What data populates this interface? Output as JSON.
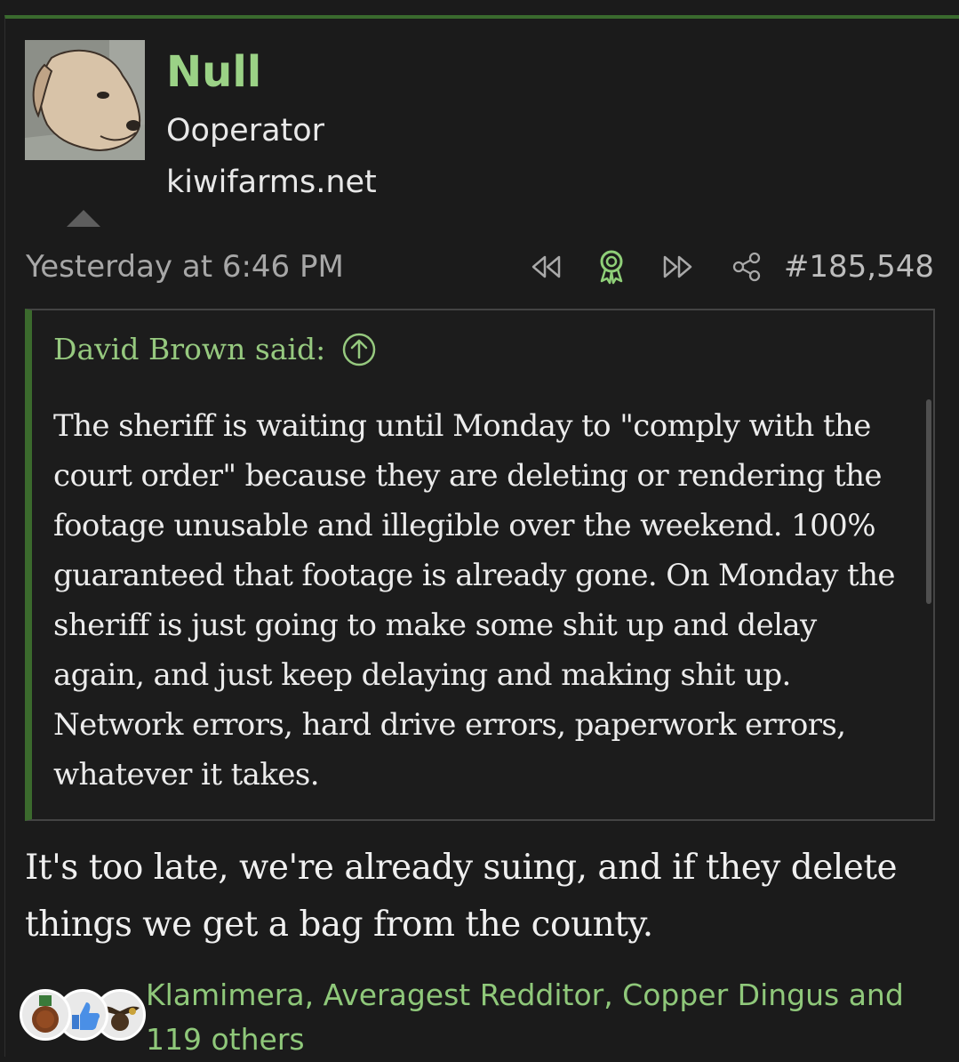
{
  "post": {
    "author": {
      "name": "Null",
      "title": "Ooperator",
      "banner": "kiwifarms.net"
    },
    "date": "Yesterday at 6:46 PM",
    "number": "#185,548",
    "actions": [
      "rewind-icon",
      "award-icon",
      "fast-forward-icon",
      "share-icon"
    ],
    "quote": {
      "attribution": "David Brown said:",
      "body": "The sheriff is waiting until Monday to \"comply with the court order\" because they are deleting or rendering the footage unusable and illegible over the weekend. 100% guaranteed that footage is already gone. On Monday the sheriff is just going to make some shit up and delay again, and just keep delaying and making shit up. Network errors, hard drive errors, paperwork errors, whatever it takes."
    },
    "message": "It's too late, we're already suing, and if they delete things we get a bag from the county.",
    "reactions": {
      "icons": [
        "medal-icon",
        "thumbs-up-icon",
        "eagle-emblem-icon"
      ],
      "users": "Klamimera, Averagest Redditor, Copper Dingus and 119 others"
    }
  },
  "colors": {
    "background": "#1b1b1b",
    "accent_green": "#9bd286",
    "quote_border": "#3b6a2d"
  }
}
